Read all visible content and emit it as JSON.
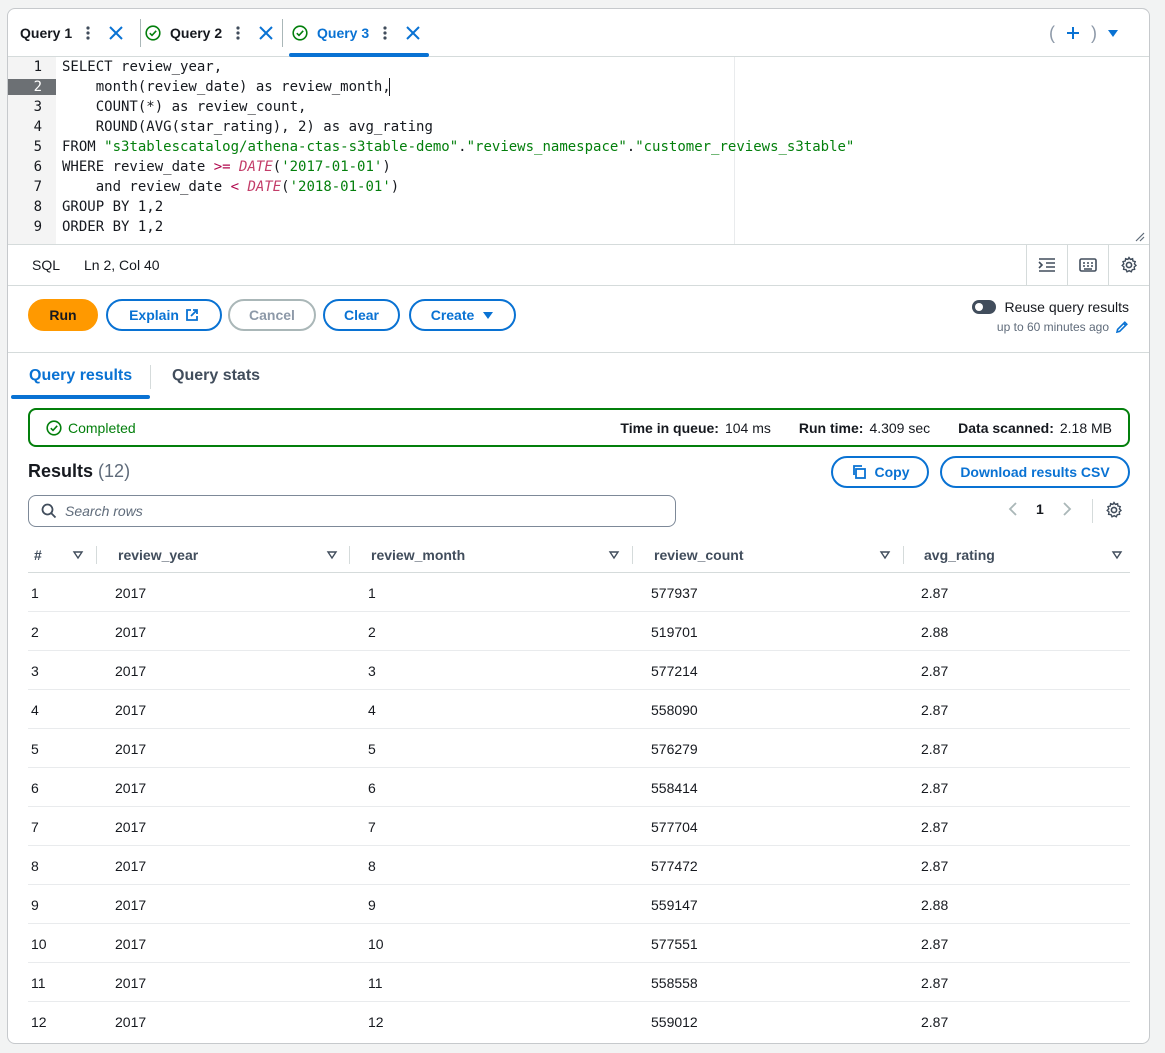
{
  "tabs": [
    {
      "label": "Query 1",
      "status": "none",
      "active": false
    },
    {
      "label": "Query 2",
      "status": "success",
      "active": false
    },
    {
      "label": "Query 3",
      "status": "success",
      "active": true
    }
  ],
  "tab_actions": {
    "open_paren": "(",
    "add_symbol": "+",
    "close_paren": ")"
  },
  "editor": {
    "active_line": 2,
    "lines": [
      {
        "n": "1",
        "tokens": [
          [
            "kw",
            "SELECT "
          ],
          [
            "plain",
            "review_year,"
          ]
        ]
      },
      {
        "n": "2",
        "tokens": [
          [
            "plain",
            "    month(review_date) "
          ],
          [
            "kw",
            "as"
          ],
          [
            "plain",
            " review_month,"
          ]
        ]
      },
      {
        "n": "3",
        "tokens": [
          [
            "plain",
            "    COUNT(*) "
          ],
          [
            "kw",
            "as"
          ],
          [
            "plain",
            " review_count,"
          ]
        ]
      },
      {
        "n": "4",
        "tokens": [
          [
            "plain",
            "    ROUND(AVG(star_rating), 2) "
          ],
          [
            "kw",
            "as"
          ],
          [
            "plain",
            " avg_rating"
          ]
        ]
      },
      {
        "n": "5",
        "tokens": [
          [
            "kw",
            "FROM "
          ],
          [
            "str",
            "\"s3tablescatalog/athena-ctas-s3table-demo\""
          ],
          [
            "plain",
            "."
          ],
          [
            "str",
            "\"reviews_namespace\""
          ],
          [
            "plain",
            "."
          ],
          [
            "str",
            "\"customer_reviews_s3table\""
          ]
        ]
      },
      {
        "n": "6",
        "tokens": [
          [
            "kw",
            "WHERE "
          ],
          [
            "plain",
            "review_date "
          ],
          [
            "op",
            ">="
          ],
          [
            "plain",
            " "
          ],
          [
            "fn",
            "DATE"
          ],
          [
            "plain",
            "("
          ],
          [
            "str",
            "'2017-01-01'"
          ],
          [
            "plain",
            ")"
          ]
        ]
      },
      {
        "n": "7",
        "tokens": [
          [
            "plain",
            "    and review_date "
          ],
          [
            "op",
            "<"
          ],
          [
            "plain",
            " "
          ],
          [
            "fn",
            "DATE"
          ],
          [
            "plain",
            "("
          ],
          [
            "str",
            "'2018-01-01'"
          ],
          [
            "plain",
            ")"
          ]
        ]
      },
      {
        "n": "8",
        "tokens": [
          [
            "kw",
            "GROUP BY "
          ],
          [
            "plain",
            "1,2"
          ]
        ]
      },
      {
        "n": "9",
        "tokens": [
          [
            "kw",
            "ORDER BY "
          ],
          [
            "plain",
            "1,2"
          ]
        ]
      }
    ]
  },
  "statusbar": {
    "language": "SQL",
    "cursor_position": "Ln 2, Col 40"
  },
  "actions": {
    "run": "Run",
    "explain": "Explain",
    "cancel": "Cancel",
    "clear": "Clear",
    "create": "Create",
    "reuse_label": "Reuse query results",
    "reuse_sub": "up to 60 minutes ago",
    "reuse_enabled": false
  },
  "result_tabs": {
    "results": "Query results",
    "stats": "Query stats"
  },
  "banner": {
    "status": "Completed",
    "queue_label": "Time in queue:",
    "queue_value": "104 ms",
    "run_label": "Run time:",
    "run_value": "4.309 sec",
    "scanned_label": "Data scanned:",
    "scanned_value": "2.18 MB"
  },
  "results": {
    "title": "Results",
    "count": "(12)",
    "copy": "Copy",
    "download": "Download results CSV",
    "search_placeholder": "Search rows",
    "page": "1",
    "columns": [
      "#",
      "review_year",
      "review_month",
      "review_count",
      "avg_rating"
    ],
    "rows": [
      [
        "1",
        "2017",
        "1",
        "577937",
        "2.87"
      ],
      [
        "2",
        "2017",
        "2",
        "519701",
        "2.88"
      ],
      [
        "3",
        "2017",
        "3",
        "577214",
        "2.87"
      ],
      [
        "4",
        "2017",
        "4",
        "558090",
        "2.87"
      ],
      [
        "5",
        "2017",
        "5",
        "576279",
        "2.87"
      ],
      [
        "6",
        "2017",
        "6",
        "558414",
        "2.87"
      ],
      [
        "7",
        "2017",
        "7",
        "577704",
        "2.87"
      ],
      [
        "8",
        "2017",
        "8",
        "577472",
        "2.87"
      ],
      [
        "9",
        "2017",
        "9",
        "559147",
        "2.88"
      ],
      [
        "10",
        "2017",
        "10",
        "577551",
        "2.87"
      ],
      [
        "11",
        "2017",
        "11",
        "558558",
        "2.87"
      ],
      [
        "12",
        "2017",
        "12",
        "559012",
        "2.87"
      ]
    ]
  },
  "colors": {
    "accent": "#0972d3",
    "success": "#037f0c",
    "primary_button": "#ff9900"
  }
}
